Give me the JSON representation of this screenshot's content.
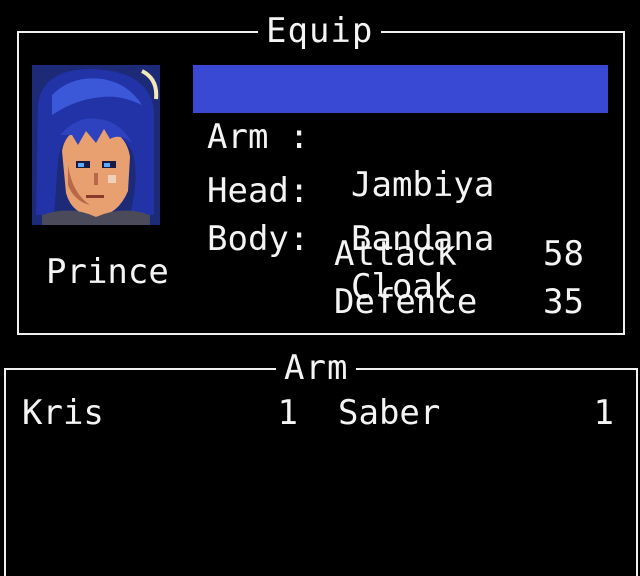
{
  "equip": {
    "title": "Equip",
    "slots": [
      {
        "label": "Arm :",
        "value": "Jambiya",
        "selected": true
      },
      {
        "label": "Head:",
        "value": "Bandana",
        "selected": false
      },
      {
        "label": "Body:",
        "value": "Cloak",
        "selected": false
      }
    ],
    "character": "Prince",
    "stats": [
      {
        "label": "Attack",
        "value": "58"
      },
      {
        "label": "Defence",
        "value": "35"
      }
    ]
  },
  "inventory": {
    "title": "Arm",
    "items": [
      {
        "name": "Kris",
        "qty": "1"
      },
      {
        "name": "Saber",
        "qty": "1"
      }
    ]
  },
  "colors": {
    "selection": "#3a49d4",
    "border": "#f0f0f0",
    "background": "#000000"
  }
}
